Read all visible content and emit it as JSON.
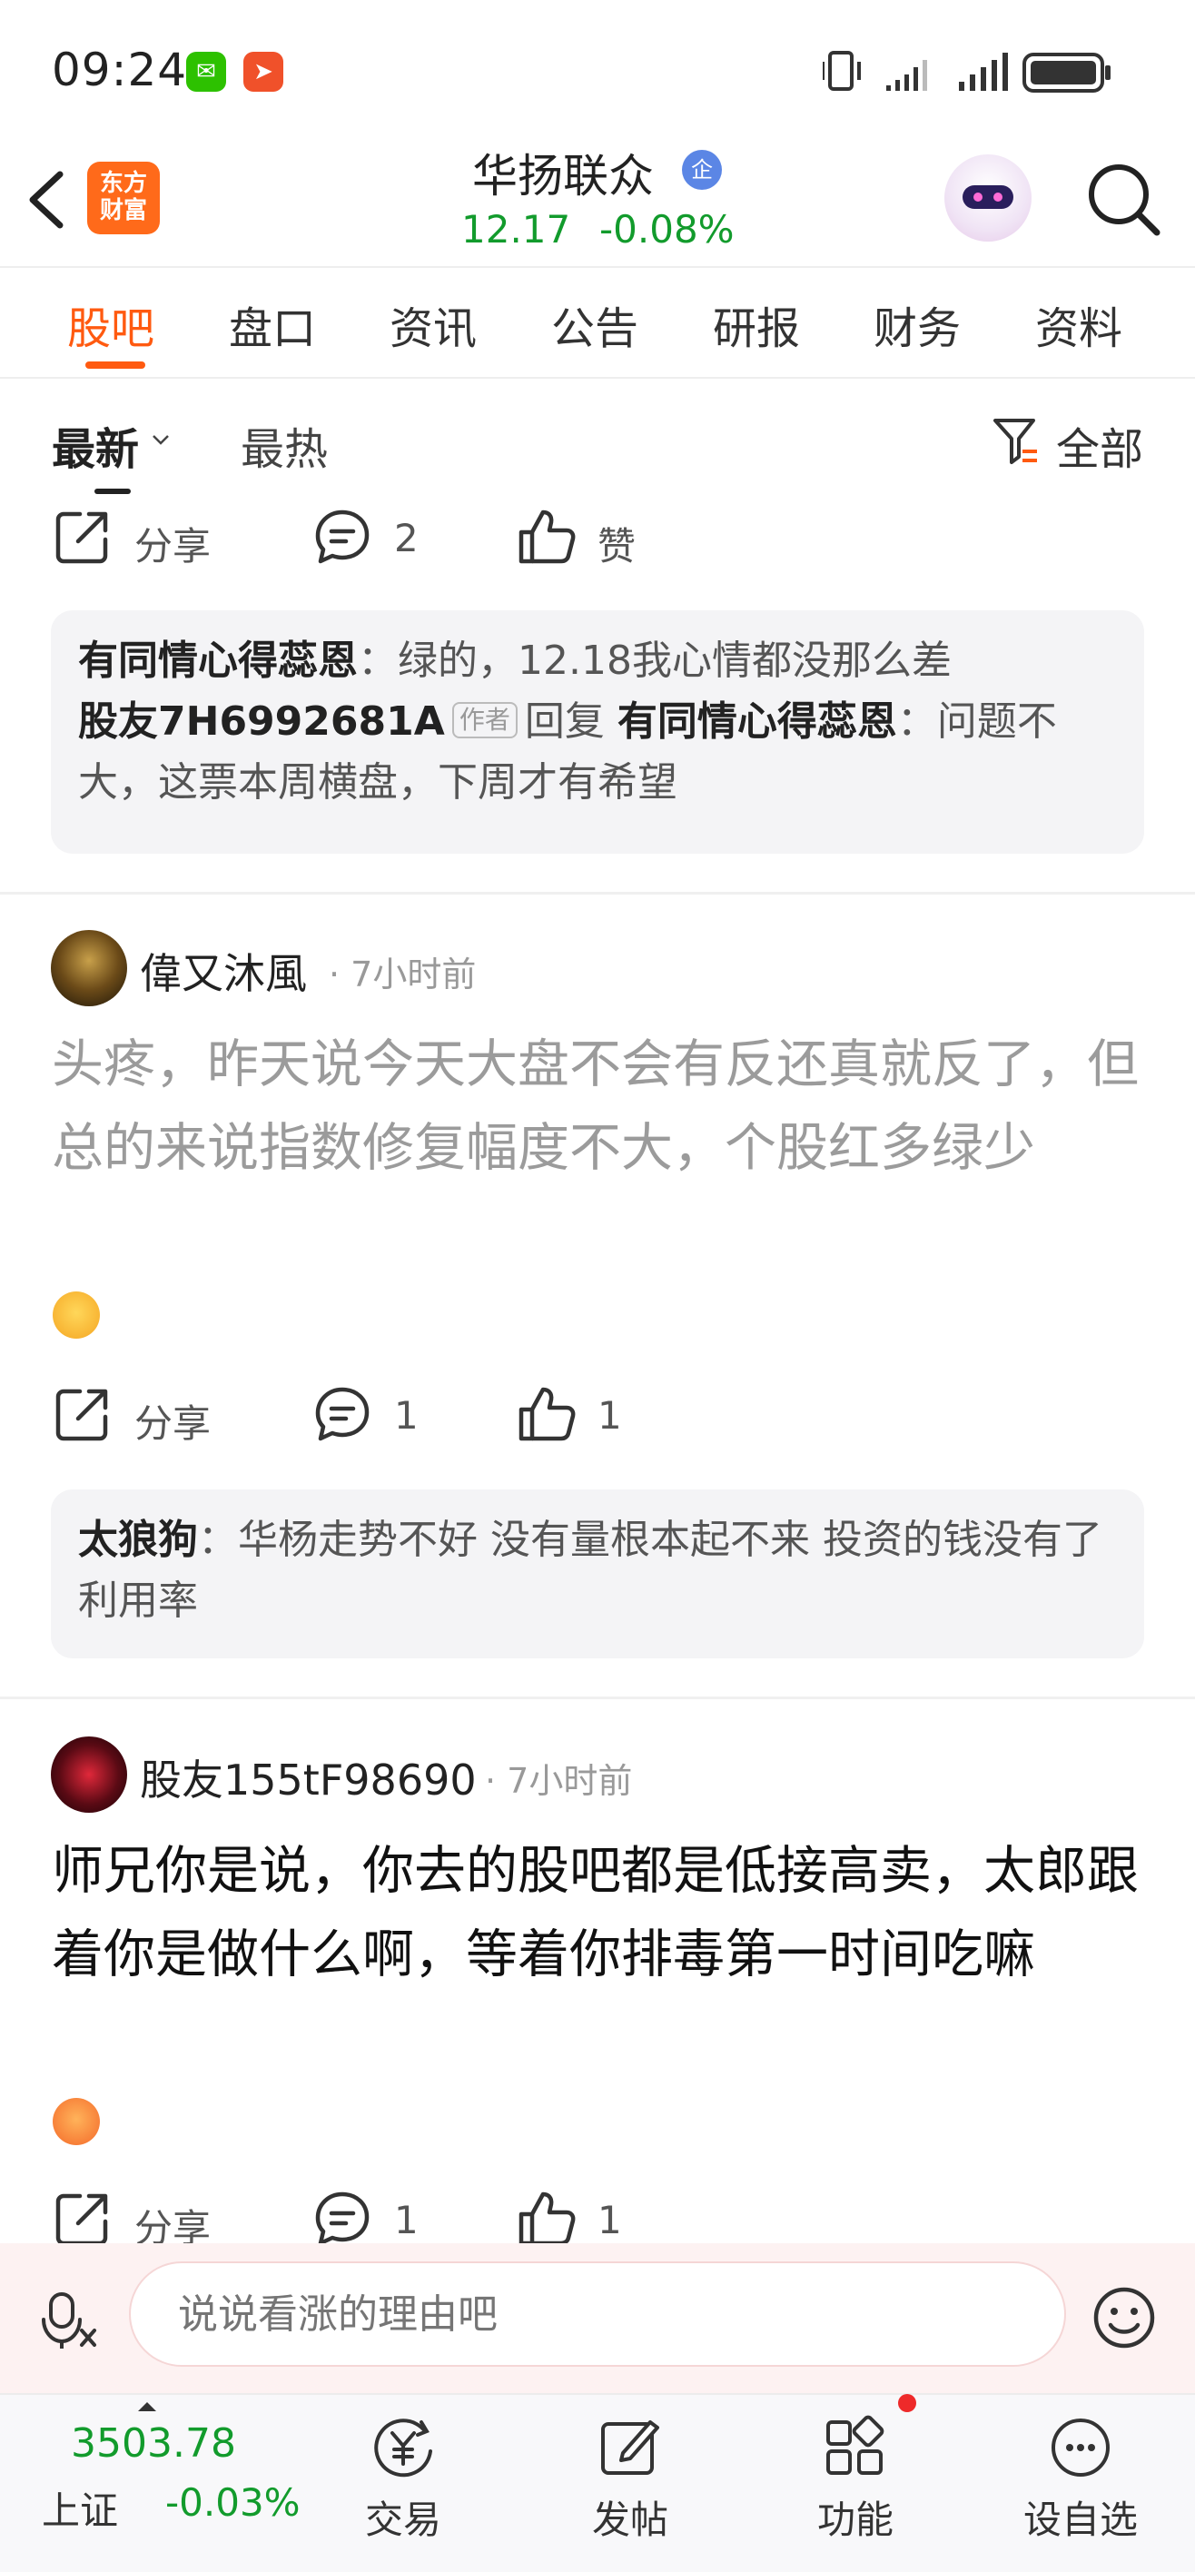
{
  "status_bar": {
    "time": "09:24",
    "app_badges": [
      "wechat-icon",
      "mail-icon"
    ],
    "battery_icon": "battery-icon"
  },
  "header": {
    "logo_text_line1": "东方",
    "logo_text_line2": "财富",
    "stock_name": "华扬联众",
    "stock_badge": "企",
    "price": "12.17",
    "change": "-0.08%",
    "price_color": "#129b2c"
  },
  "tabs": [
    {
      "label": "股吧",
      "active": true
    },
    {
      "label": "盘口"
    },
    {
      "label": "资讯"
    },
    {
      "label": "公告"
    },
    {
      "label": "研报"
    },
    {
      "label": "财务"
    },
    {
      "label": "资料"
    }
  ],
  "sort": {
    "latest": "最新",
    "hot": "最热",
    "filter": "全部"
  },
  "first_post_actions": {
    "share": "分享",
    "comments": "2",
    "like": "赞"
  },
  "reply_box_1": {
    "user1": "有同情心得蕊恩",
    "text1": "：绿的，12.18我心情都没那么差",
    "user2": "股友7H6992681A",
    "author_tag": "作者",
    "reply_word": "回复",
    "reply_to": "有同情心得蕊恩",
    "text2": "：问题不大，这票本周横盘，下周才有希望"
  },
  "post2": {
    "username": "偉又沐風",
    "time": "· 7小时前",
    "body": "头疼，昨天说今天大盘不会有反还真就反了，但总的来说指数修复幅度不大，个股红多绿少",
    "share": "分享",
    "comments": "1",
    "likes": "1",
    "reply_user": "太狼狗",
    "reply_text": "：华杨走势不好 没有量根本起不来 投资的钱没有了利用率"
  },
  "post3": {
    "username": "股友155tF98690",
    "time": "· 7小时前",
    "body": "师兄你是说，你去的股吧都是低接高卖，太郎跟着你是做什么啊，等着你排毒第一时间吃嘛",
    "share": "分享",
    "comments": "1",
    "likes": "1"
  },
  "input_bar": {
    "placeholder": "说说看涨的理由吧"
  },
  "bottom_nav": {
    "index_value": "3503.78",
    "index_name": "上证",
    "index_change": "-0.03%",
    "items": [
      {
        "label": "交易",
        "icon": "trade-yen-icon"
      },
      {
        "label": "发帖",
        "icon": "edit-icon"
      },
      {
        "label": "功能",
        "icon": "grid-icon"
      },
      {
        "label": "设自选",
        "icon": "more-icon"
      }
    ]
  }
}
